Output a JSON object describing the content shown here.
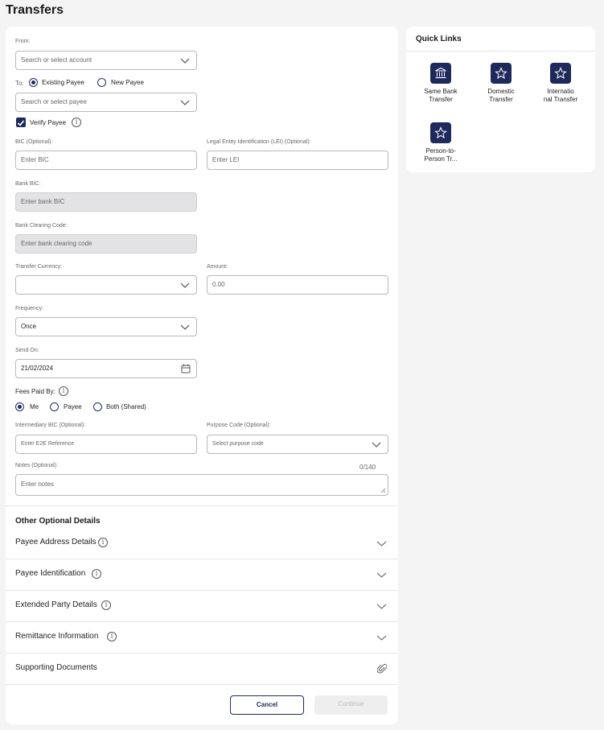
{
  "page": {
    "title": "Transfers"
  },
  "form": {
    "from_label": "From:",
    "from_placeholder": "Search or select account",
    "to_label": "To:",
    "to_options": [
      "Existing Payee",
      "New Payee"
    ],
    "to_selected": "Existing Payee",
    "payee_placeholder": "Search or select payee",
    "verify_payee": {
      "label": "Verify Payee",
      "checked": true
    },
    "bic_label": "BIC (Optional):",
    "bic_placeholder": "Enter BIC",
    "lei_label": "Legal Entity Identification (LEI) (Optional):",
    "lei_placeholder": "Enter LEI",
    "bank_bic_label": "Bank BIC:",
    "bank_bic_placeholder": "Enter bank BIC",
    "clearing_label": "Bank Clearing Code:",
    "clearing_placeholder": "Enter bank clearing code",
    "currency_label": "Transfer Currency:",
    "currency_value": "",
    "amount_label": "Amount:",
    "amount_placeholder": "0.00",
    "frequency_label": "Frequency:",
    "frequency_value": "Once",
    "send_on_label": "Send On:",
    "send_on_value": "21/02/2024",
    "fees_label": "Fees Paid By:",
    "fees_options": [
      "Me",
      "Payee",
      "Both (Shared)"
    ],
    "fees_selected": "Me",
    "intermediary_label": "Intermediary BIC (Optional):",
    "intermediary_placeholder": "Enter E2E Reference",
    "purpose_label": "Purpose Code (Optional):",
    "purpose_placeholder": "Select purpose code",
    "notes_label": "Notes (Optional):",
    "notes_counter": "0/140",
    "notes_placeholder": "Enter notes"
  },
  "optional": {
    "title": "Other Optional Details",
    "rows": [
      "Payee Address Details",
      "Payee Identification",
      "Extended Party Details",
      "Remittance Information",
      "Supporting Documents"
    ]
  },
  "actions": {
    "cancel": "Cancel",
    "continue": "Continue"
  },
  "quick_links": {
    "title": "Quick Links",
    "items": [
      {
        "line1": "Same Bank",
        "line2": "Transfer",
        "icon": "bank-icon"
      },
      {
        "line1": "Domestic",
        "line2": "Transfer",
        "icon": "star-icon"
      },
      {
        "line1": "Internatio",
        "line2": "nal Transfer",
        "icon": "star-icon"
      },
      {
        "line1": "Person-to-",
        "line2": "Person Tr...",
        "icon": "star-icon"
      }
    ]
  },
  "colors": {
    "accent": "#1f2a5c",
    "page_bg": "#f4f4f5",
    "disabled_field": "#e3e3e6"
  }
}
